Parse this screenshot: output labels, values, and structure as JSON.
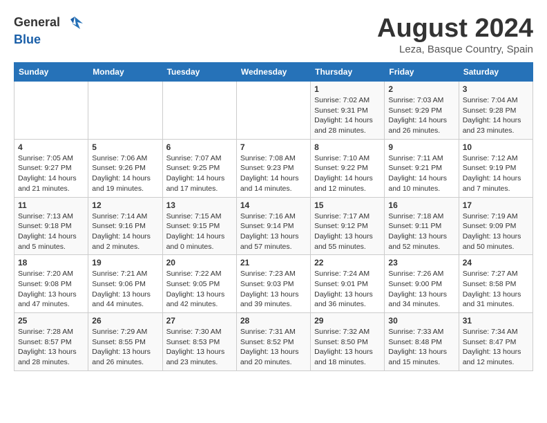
{
  "header": {
    "logo_general": "General",
    "logo_blue": "Blue",
    "title": "August 2024",
    "subtitle": "Leza, Basque Country, Spain"
  },
  "calendar": {
    "days_of_week": [
      "Sunday",
      "Monday",
      "Tuesday",
      "Wednesday",
      "Thursday",
      "Friday",
      "Saturday"
    ],
    "weeks": [
      [
        {
          "day": "",
          "info": ""
        },
        {
          "day": "",
          "info": ""
        },
        {
          "day": "",
          "info": ""
        },
        {
          "day": "",
          "info": ""
        },
        {
          "day": "1",
          "info": "Sunrise: 7:02 AM\nSunset: 9:31 PM\nDaylight: 14 hours\nand 28 minutes."
        },
        {
          "day": "2",
          "info": "Sunrise: 7:03 AM\nSunset: 9:29 PM\nDaylight: 14 hours\nand 26 minutes."
        },
        {
          "day": "3",
          "info": "Sunrise: 7:04 AM\nSunset: 9:28 PM\nDaylight: 14 hours\nand 23 minutes."
        }
      ],
      [
        {
          "day": "4",
          "info": "Sunrise: 7:05 AM\nSunset: 9:27 PM\nDaylight: 14 hours\nand 21 minutes."
        },
        {
          "day": "5",
          "info": "Sunrise: 7:06 AM\nSunset: 9:26 PM\nDaylight: 14 hours\nand 19 minutes."
        },
        {
          "day": "6",
          "info": "Sunrise: 7:07 AM\nSunset: 9:25 PM\nDaylight: 14 hours\nand 17 minutes."
        },
        {
          "day": "7",
          "info": "Sunrise: 7:08 AM\nSunset: 9:23 PM\nDaylight: 14 hours\nand 14 minutes."
        },
        {
          "day": "8",
          "info": "Sunrise: 7:10 AM\nSunset: 9:22 PM\nDaylight: 14 hours\nand 12 minutes."
        },
        {
          "day": "9",
          "info": "Sunrise: 7:11 AM\nSunset: 9:21 PM\nDaylight: 14 hours\nand 10 minutes."
        },
        {
          "day": "10",
          "info": "Sunrise: 7:12 AM\nSunset: 9:19 PM\nDaylight: 14 hours\nand 7 minutes."
        }
      ],
      [
        {
          "day": "11",
          "info": "Sunrise: 7:13 AM\nSunset: 9:18 PM\nDaylight: 14 hours\nand 5 minutes."
        },
        {
          "day": "12",
          "info": "Sunrise: 7:14 AM\nSunset: 9:16 PM\nDaylight: 14 hours\nand 2 minutes."
        },
        {
          "day": "13",
          "info": "Sunrise: 7:15 AM\nSunset: 9:15 PM\nDaylight: 14 hours\nand 0 minutes."
        },
        {
          "day": "14",
          "info": "Sunrise: 7:16 AM\nSunset: 9:14 PM\nDaylight: 13 hours\nand 57 minutes."
        },
        {
          "day": "15",
          "info": "Sunrise: 7:17 AM\nSunset: 9:12 PM\nDaylight: 13 hours\nand 55 minutes."
        },
        {
          "day": "16",
          "info": "Sunrise: 7:18 AM\nSunset: 9:11 PM\nDaylight: 13 hours\nand 52 minutes."
        },
        {
          "day": "17",
          "info": "Sunrise: 7:19 AM\nSunset: 9:09 PM\nDaylight: 13 hours\nand 50 minutes."
        }
      ],
      [
        {
          "day": "18",
          "info": "Sunrise: 7:20 AM\nSunset: 9:08 PM\nDaylight: 13 hours\nand 47 minutes."
        },
        {
          "day": "19",
          "info": "Sunrise: 7:21 AM\nSunset: 9:06 PM\nDaylight: 13 hours\nand 44 minutes."
        },
        {
          "day": "20",
          "info": "Sunrise: 7:22 AM\nSunset: 9:05 PM\nDaylight: 13 hours\nand 42 minutes."
        },
        {
          "day": "21",
          "info": "Sunrise: 7:23 AM\nSunset: 9:03 PM\nDaylight: 13 hours\nand 39 minutes."
        },
        {
          "day": "22",
          "info": "Sunrise: 7:24 AM\nSunset: 9:01 PM\nDaylight: 13 hours\nand 36 minutes."
        },
        {
          "day": "23",
          "info": "Sunrise: 7:26 AM\nSunset: 9:00 PM\nDaylight: 13 hours\nand 34 minutes."
        },
        {
          "day": "24",
          "info": "Sunrise: 7:27 AM\nSunset: 8:58 PM\nDaylight: 13 hours\nand 31 minutes."
        }
      ],
      [
        {
          "day": "25",
          "info": "Sunrise: 7:28 AM\nSunset: 8:57 PM\nDaylight: 13 hours\nand 28 minutes."
        },
        {
          "day": "26",
          "info": "Sunrise: 7:29 AM\nSunset: 8:55 PM\nDaylight: 13 hours\nand 26 minutes."
        },
        {
          "day": "27",
          "info": "Sunrise: 7:30 AM\nSunset: 8:53 PM\nDaylight: 13 hours\nand 23 minutes."
        },
        {
          "day": "28",
          "info": "Sunrise: 7:31 AM\nSunset: 8:52 PM\nDaylight: 13 hours\nand 20 minutes."
        },
        {
          "day": "29",
          "info": "Sunrise: 7:32 AM\nSunset: 8:50 PM\nDaylight: 13 hours\nand 18 minutes."
        },
        {
          "day": "30",
          "info": "Sunrise: 7:33 AM\nSunset: 8:48 PM\nDaylight: 13 hours\nand 15 minutes."
        },
        {
          "day": "31",
          "info": "Sunrise: 7:34 AM\nSunset: 8:47 PM\nDaylight: 13 hours\nand 12 minutes."
        }
      ]
    ]
  }
}
